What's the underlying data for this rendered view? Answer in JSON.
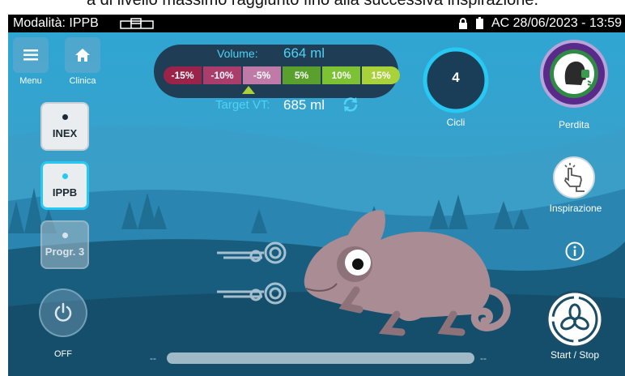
{
  "caption": "a di livello massimo raggiunto fino alla successiva inspirazione.",
  "status_bar": {
    "mode_label": "Modalità: IPPB",
    "power_source": "AC",
    "datetime": "28/06/2023 - 13:59"
  },
  "nav": {
    "menu_label": "Menu",
    "clinic_label": "Clinica"
  },
  "modes": [
    {
      "label": "INEX",
      "state": "normal"
    },
    {
      "label": "IPPB",
      "state": "active"
    },
    {
      "label": "Progr. 3",
      "state": "disabled"
    }
  ],
  "power": {
    "label": "OFF"
  },
  "volume": {
    "title": "Volume:",
    "value": "664 ml",
    "target_label": "Target VT:",
    "target_value": "685 ml",
    "scale": [
      {
        "label": "-15%",
        "color": "#9b2248"
      },
      {
        "label": "-10%",
        "color": "#ab3d6a"
      },
      {
        "label": "-5%",
        "color": "#c07aa8"
      },
      {
        "label": "5%",
        "color": "#5aa02c"
      },
      {
        "label": "10%",
        "color": "#7dc233"
      },
      {
        "label": "15%",
        "color": "#a8d13a"
      }
    ],
    "marker_segment": "-5%"
  },
  "cycles": {
    "value": "4",
    "label": "Cicli"
  },
  "leak": {
    "label": "Perdita"
  },
  "inspiration": {
    "label": "Inspirazione"
  },
  "start_stop": {
    "label": "Start / Stop"
  },
  "slider": {
    "min_label": "--",
    "max_label": "--"
  },
  "colors": {
    "accent": "#27c8f2",
    "sky": "#2c97c6",
    "ground": "#176080",
    "ring_purple": "#5a2a8a",
    "ring_green": "#2f8a44"
  }
}
